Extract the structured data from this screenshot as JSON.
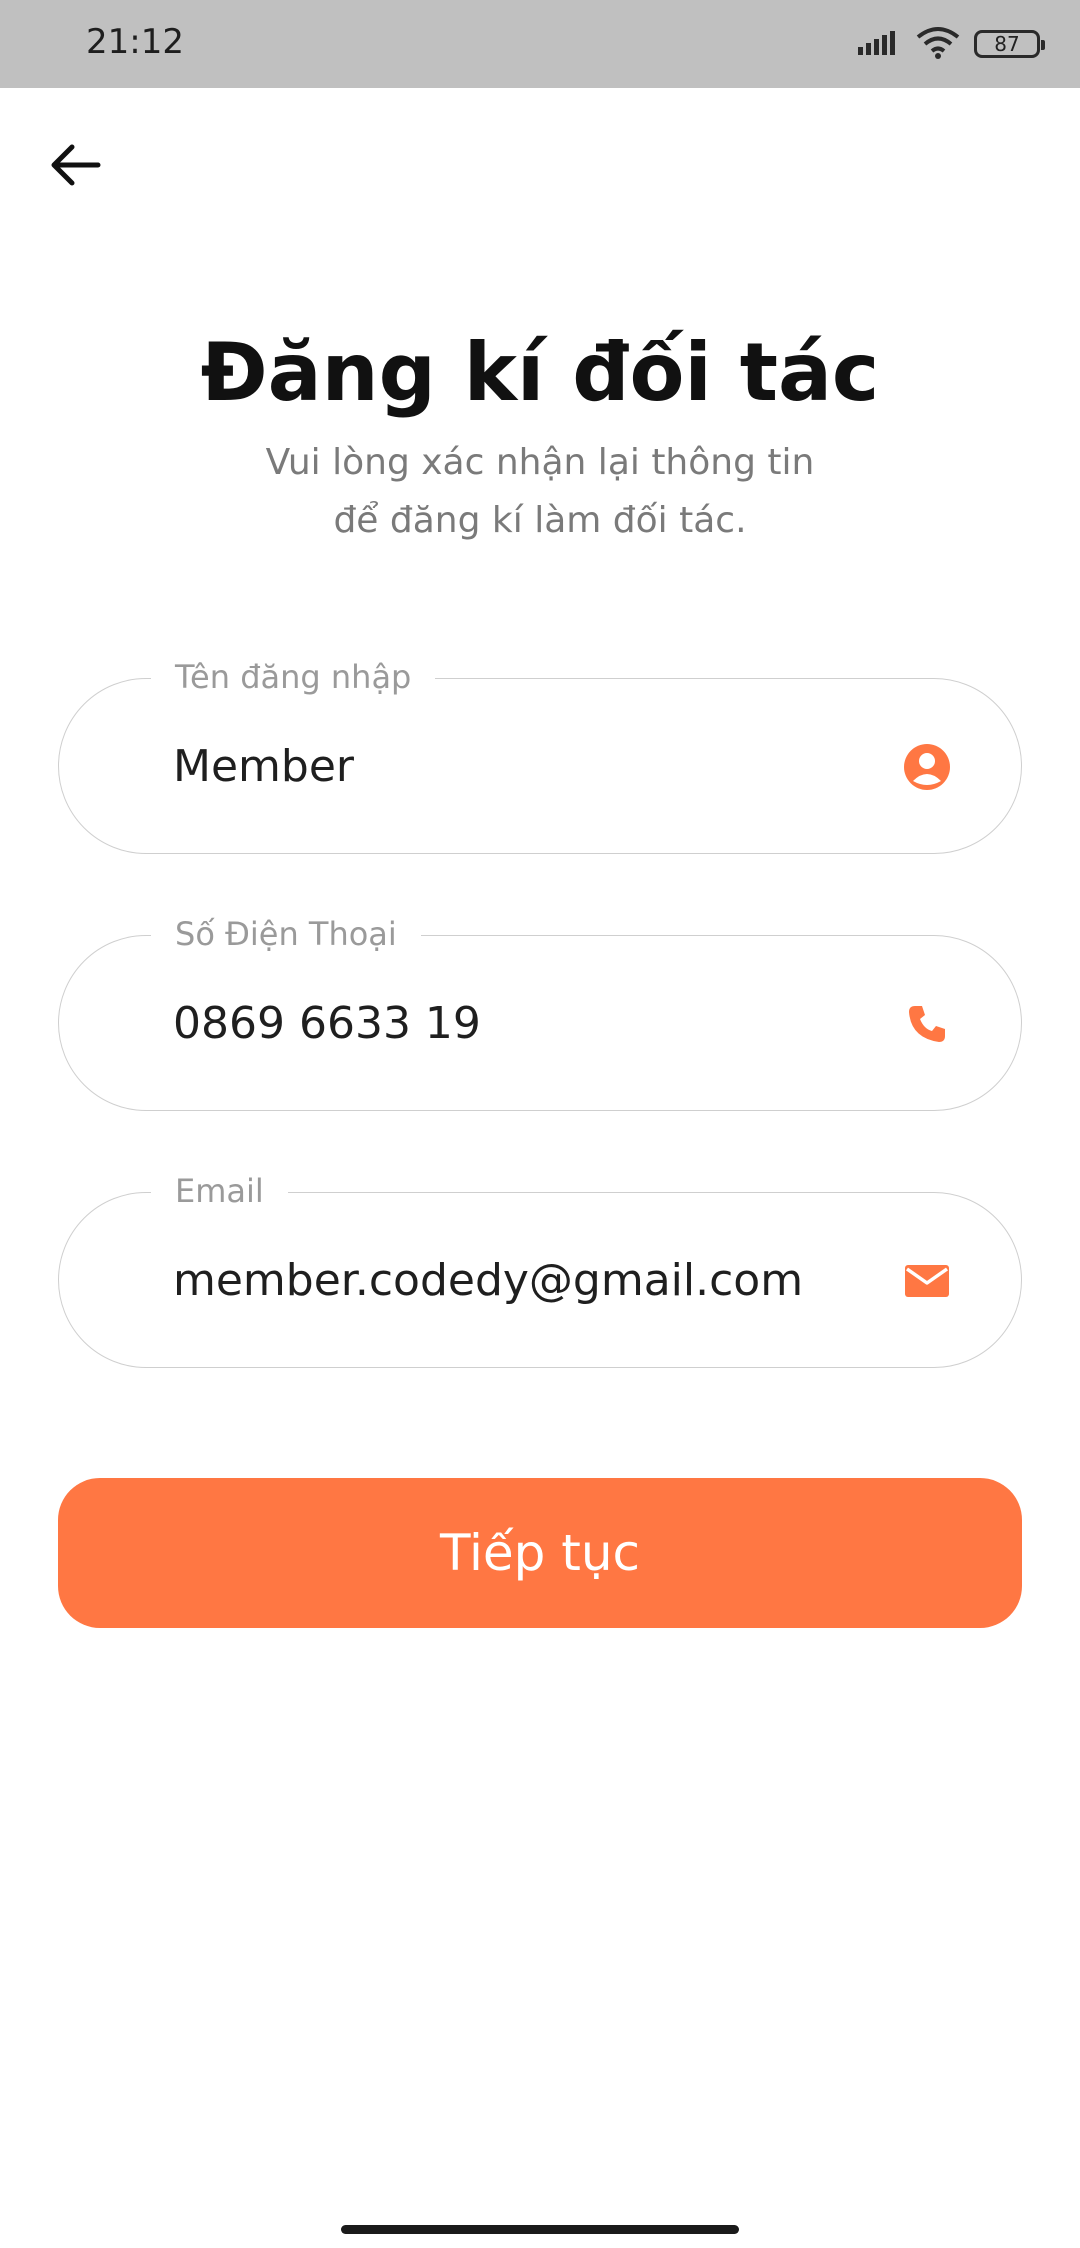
{
  "status_bar": {
    "time": "21:12",
    "battery": "87",
    "icons": [
      "signal-icon",
      "wifi-icon",
      "battery-icon"
    ]
  },
  "header": {
    "back_icon": "arrow-left-icon",
    "title": "Đăng kí đối tác",
    "subtitle_line1": "Vui lòng xác nhận lại thông tin",
    "subtitle_line2": "để đăng kí làm đối tác."
  },
  "form": {
    "username": {
      "label": "Tên đăng nhập",
      "value": "Member",
      "icon": "user-icon"
    },
    "phone": {
      "label": "Số Điện Thoại",
      "value": "0869 6633 19",
      "icon": "phone-icon"
    },
    "email": {
      "label": "Email",
      "value": "member.codedy@gmail.com",
      "icon": "mail-icon"
    }
  },
  "actions": {
    "continue_label": "Tiếp tục"
  },
  "colors": {
    "accent": "#ff7743",
    "status_bar": "#c0c0c0",
    "border": "#cfcfcf"
  }
}
